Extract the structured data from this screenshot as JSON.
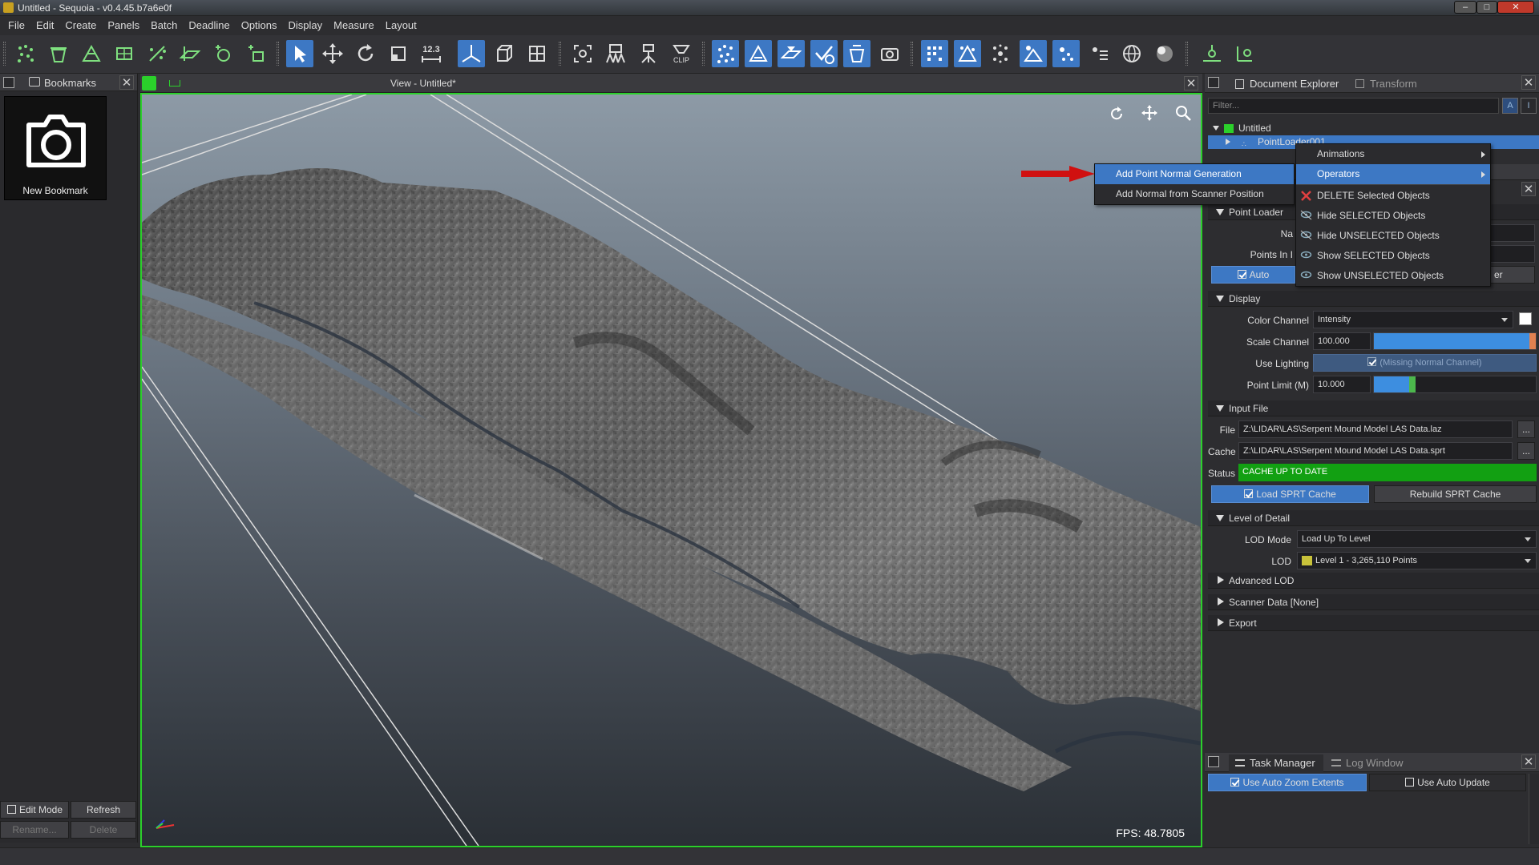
{
  "window": {
    "title": "Untitled - Sequoia - v0.4.45.b7a6e0f"
  },
  "menu": [
    "File",
    "Edit",
    "Create",
    "Panels",
    "Batch",
    "Deadline",
    "Options",
    "Display",
    "Measure",
    "Layout"
  ],
  "toolbar": {
    "measure_label": "12.3",
    "clip_label": "CLIP"
  },
  "bookmarks": {
    "tab": "Bookmarks",
    "new_bookmark": "New Bookmark",
    "edit_mode": "Edit Mode",
    "refresh": "Refresh",
    "rename": "Rename...",
    "delete": "Delete"
  },
  "viewport": {
    "title": "View - Untitled*",
    "fps": "FPS:  48.7805"
  },
  "explorer": {
    "tab_document": "Document Explorer",
    "tab_transform": "Transform",
    "filter_placeholder": "Filter...",
    "filter_a": "A",
    "filter_i": "I",
    "root": "Untitled",
    "child": "PointLoader001"
  },
  "context_menu_left": {
    "items": [
      "Add Point Normal Generation",
      "Add Normal from Scanner Position"
    ]
  },
  "context_menu_right": {
    "items": [
      "Animations",
      "Operators",
      "DELETE Selected Objects",
      "Hide SELECTED Objects",
      "Hide UNSELECTED Objects",
      "Show SELECTED Objects",
      "Show UNSELECTED Objects"
    ]
  },
  "properties": {
    "point_loader": "Point Loader",
    "name_label": "Na",
    "points_label": "Points In I",
    "auto_label": "Auto",
    "auto_right": "er",
    "display": "Display",
    "color_channel_label": "Color Channel",
    "color_channel_value": "Intensity",
    "scale_channel_label": "Scale Channel",
    "scale_channel_value": "100.000",
    "scale_fill": 0.98,
    "use_lighting_label": "Use Lighting",
    "use_lighting_value": "(Missing Normal Channel)",
    "point_limit_label": "Point Limit (M)",
    "point_limit_value": "10.000",
    "point_limit_fill": 0.22,
    "input_file": "Input File",
    "file_label": "File",
    "file_value": "Z:\\LIDAR\\LAS\\Serpent Mound Model LAS Data.laz",
    "cache_label": "Cache",
    "cache_value": "Z:\\LIDAR\\LAS\\Serpent Mound Model LAS Data.sprt",
    "status_label": "Status",
    "status_value": "CACHE UP TO DATE",
    "load_cache": "Load SPRT Cache",
    "rebuild_cache": "Rebuild SPRT Cache",
    "browse": "...",
    "lod": "Level of Detail",
    "lod_mode_label": "LOD Mode",
    "lod_mode_value": "Load Up To Level",
    "lod_label": "LOD",
    "lod_value": "Level 1 - 3,265,110 Points",
    "advanced_lod": "Advanced LOD",
    "scanner_data": "Scanner Data   [None]",
    "export": "Export"
  },
  "tasks": {
    "tab_task": "Task Manager",
    "tab_log": "Log Window",
    "auto_zoom": "Use Auto Zoom Extents",
    "auto_update": "Use Auto Update"
  },
  "colors": {
    "accent": "#3d78c4",
    "viewport_border": "#2bd02b",
    "status_ok": "#12a012",
    "arrow": "#d01010",
    "lod_swatch": "#c8c23a"
  }
}
